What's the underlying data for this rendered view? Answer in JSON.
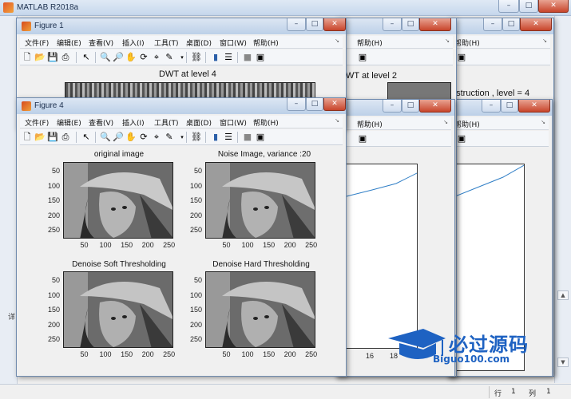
{
  "main": {
    "title": "MATLAB R2018a",
    "left_label": "详",
    "status": {
      "row_label": "行",
      "row": "1",
      "col_label": "列",
      "col": "1"
    }
  },
  "menu": [
    "文件(F)",
    "编辑(E)",
    "查看(V)",
    "插入(I)",
    "工具(T)",
    "桌面(D)",
    "窗口(W)",
    "帮助(H)"
  ],
  "help_menu": "帮助(H)",
  "figure1": {
    "title": "Figure 1",
    "axes_title": "DWT at level 4"
  },
  "figure_mid": {
    "axes_title": "WT at level 2",
    "x_ticks": [
      "16",
      "18"
    ]
  },
  "figure_right": {
    "axes_title": "nstruction , level = 4"
  },
  "figure4": {
    "title": "Figure 4",
    "subplots": [
      {
        "title": "original image"
      },
      {
        "title": "Noise Image,  variance :20"
      },
      {
        "title": "Denoise Soft Thresholding"
      },
      {
        "title": "Denoise Hard Thresholding"
      }
    ],
    "y_ticks": [
      "50",
      "100",
      "150",
      "200",
      "250"
    ],
    "x_ticks": [
      "50",
      "100",
      "150",
      "200",
      "250"
    ]
  },
  "watermark": {
    "text": "必过源码",
    "url": "Biguo100.com"
  },
  "colors": {
    "title_bar": "#c6d7ec",
    "line": "#2f7ec6",
    "watermark": "#1e62c2"
  }
}
